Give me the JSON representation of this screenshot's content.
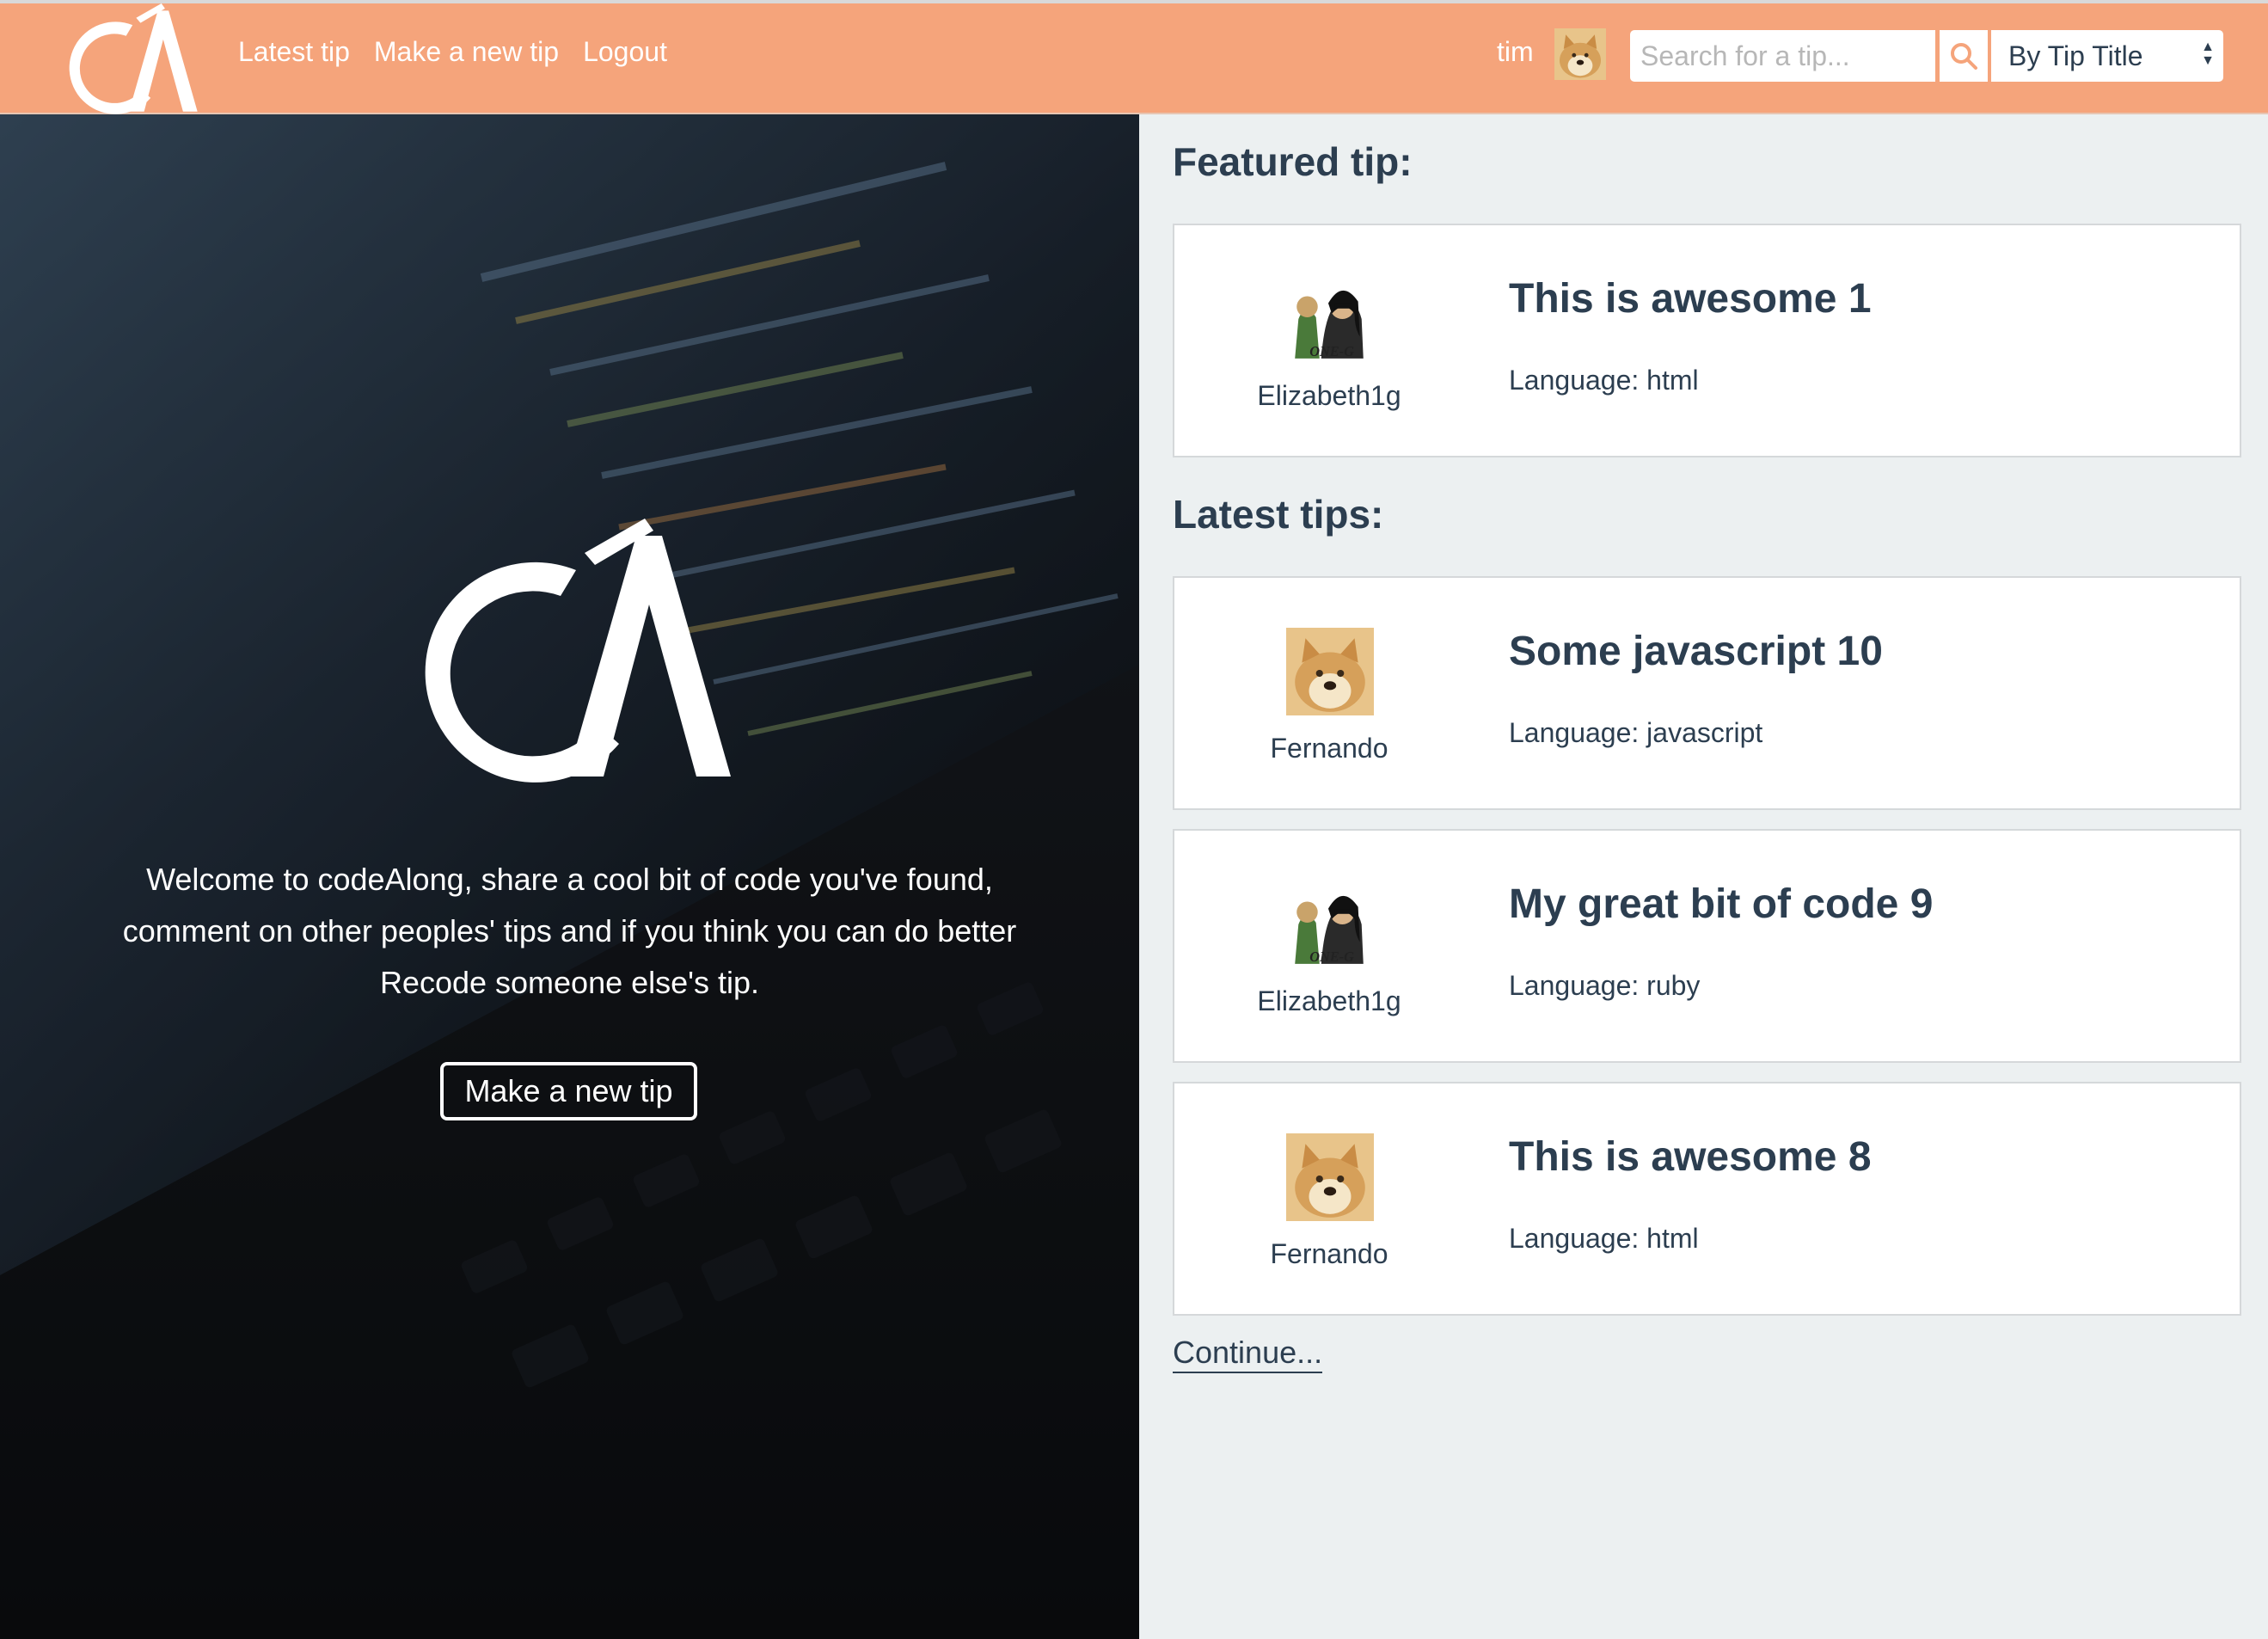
{
  "nav": {
    "links": [
      "Latest tip",
      "Make a new tip",
      "Logout"
    ],
    "username": "tim",
    "search_placeholder": "Search for a tip...",
    "search_by": "By Tip Title"
  },
  "hero": {
    "welcome_text": "Welcome to codeAlong, share a cool bit of code you've found, comment on other peoples' tips and if you think you can do better Recode someone else's tip.",
    "button_label": "Make a new tip"
  },
  "featured": {
    "heading": "Featured tip:",
    "tip": {
      "author": "Elizabeth1g",
      "title": "This is awesome 1",
      "language": "Language: html",
      "avatar": "one-g-avatar"
    }
  },
  "latest": {
    "heading": "Latest tips:",
    "tips": [
      {
        "author": "Fernando",
        "title": "Some javascript 10",
        "language": "Language: javascript",
        "avatar": "doge-avatar"
      },
      {
        "author": "Elizabeth1g",
        "title": "My great bit of code 9",
        "language": "Language: ruby",
        "avatar": "one-g-avatar"
      },
      {
        "author": "Fernando",
        "title": "This is awesome 8",
        "language": "Language: html",
        "avatar": "doge-avatar"
      }
    ],
    "continue_label": "Continue..."
  },
  "colors": {
    "navbar": "#f5a47b",
    "text_dark": "#2c3e50",
    "page_bg": "#ecf0f1"
  }
}
